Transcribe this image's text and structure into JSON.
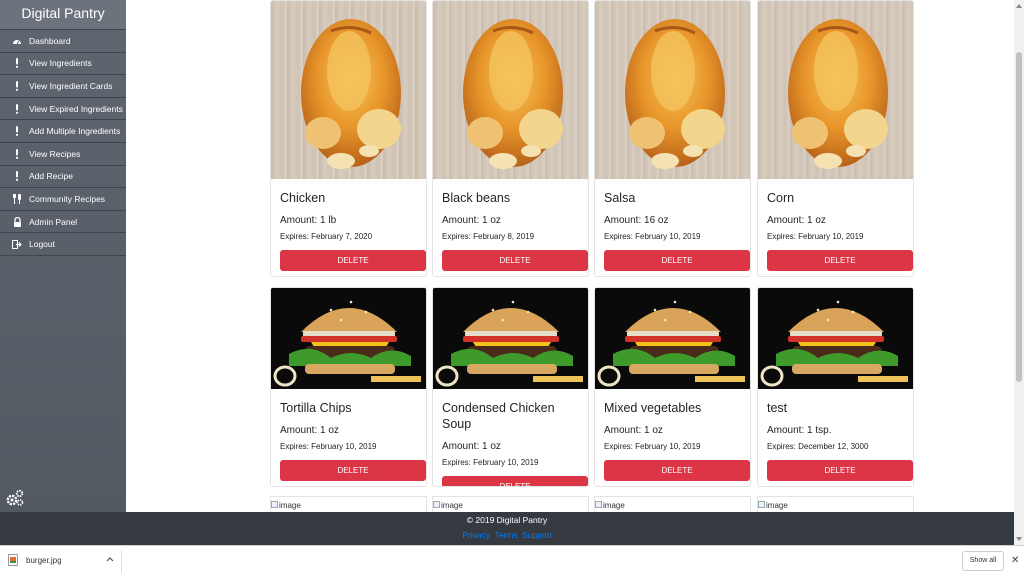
{
  "brand": "Digital Pantry",
  "nav": [
    {
      "label": "Dashboard",
      "icon": "dashboard-icon"
    },
    {
      "label": "View Ingredients",
      "icon": "exclamation-icon"
    },
    {
      "label": "View Ingredient Cards",
      "icon": "exclamation-icon"
    },
    {
      "label": "View Expired Ingredients",
      "icon": "exclamation-icon"
    },
    {
      "label": "Add Multiple Ingredients",
      "icon": "exclamation-icon"
    },
    {
      "label": "View Recipes",
      "icon": "exclamation-icon"
    },
    {
      "label": "Add Recipe",
      "icon": "exclamation-icon"
    },
    {
      "label": "Community Recipes",
      "icon": "utensils-icon"
    },
    {
      "label": "Admin Panel",
      "icon": "user-lock-icon"
    },
    {
      "label": "Logout",
      "icon": "sign-out-icon"
    }
  ],
  "cards": [
    {
      "name": "Chicken",
      "amount": "Amount: 1 lb",
      "expires": "Expires: February 7, 2020",
      "delete": "DELETE",
      "image": "chicken"
    },
    {
      "name": "Black beans",
      "amount": "Amount: 1 oz",
      "expires": "Expires: February 8, 2019",
      "delete": "DELETE",
      "image": "chicken"
    },
    {
      "name": "Salsa",
      "amount": "Amount: 16 oz",
      "expires": "Expires: February 10, 2019",
      "delete": "DELETE",
      "image": "chicken"
    },
    {
      "name": "Corn",
      "amount": "Amount: 1 oz",
      "expires": "Expires: February 10, 2019",
      "delete": "DELETE",
      "image": "chicken"
    },
    {
      "name": "Tortilla Chips",
      "amount": "Amount: 1 oz",
      "expires": "Expires: February 10, 2019",
      "delete": "DELETE",
      "image": "burger"
    },
    {
      "name": "Condensed Chicken Soup",
      "amount": "Amount: 1 oz",
      "expires": "Expires: February 10, 2019",
      "delete": "DELETE",
      "image": "burger"
    },
    {
      "name": "Mixed vegetables",
      "amount": "Amount: 1 oz",
      "expires": "Expires: February 10, 2019",
      "delete": "DELETE",
      "image": "burger"
    },
    {
      "name": "test",
      "amount": "Amount: 1 tsp.",
      "expires": "Expires: December 12, 3000",
      "delete": "DELETE",
      "image": "burger"
    }
  ],
  "broken_images": [
    "image",
    "image",
    "image",
    "image"
  ],
  "footer": {
    "copyright": "© 2019 Digital Pantry",
    "links": [
      "Privacy",
      "Terms",
      "Support"
    ]
  },
  "downloads": {
    "file": "burger.jpg",
    "show_all": "Show all"
  },
  "colors": {
    "sidebar": "#5f6670",
    "delete_button": "#dc3545",
    "footer": "#343a40",
    "link": "#007bff"
  }
}
